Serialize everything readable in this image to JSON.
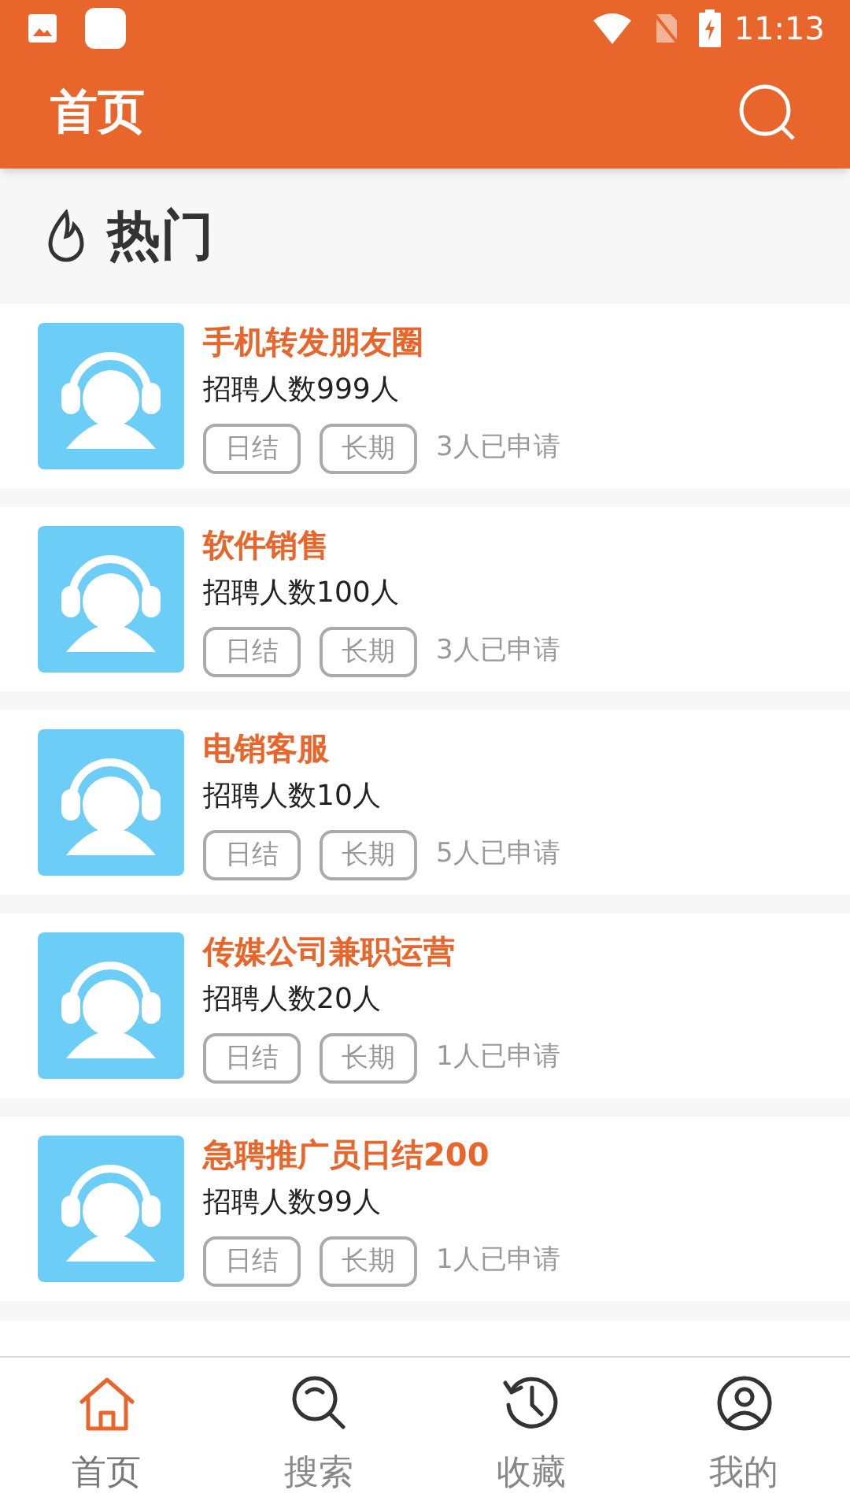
{
  "status_bar": {
    "time": "11:13"
  },
  "header": {
    "title": "首页"
  },
  "section": {
    "title": "热门"
  },
  "jobs": [
    {
      "title": "手机转发朋友圈",
      "recruit": "招聘人数999人",
      "tags": [
        "日结",
        "长期"
      ],
      "applied": "3人已申请"
    },
    {
      "title": "软件销售",
      "recruit": "招聘人数100人",
      "tags": [
        "日结",
        "长期"
      ],
      "applied": "3人已申请"
    },
    {
      "title": "电销客服",
      "recruit": "招聘人数10人",
      "tags": [
        "日结",
        "长期"
      ],
      "applied": "5人已申请"
    },
    {
      "title": "传媒公司兼职运营",
      "recruit": "招聘人数20人",
      "tags": [
        "日结",
        "长期"
      ],
      "applied": "1人已申请"
    },
    {
      "title": "急聘推广员日结200",
      "recruit": "招聘人数99人",
      "tags": [
        "日结",
        "长期"
      ],
      "applied": "1人已申请"
    }
  ],
  "bottom_nav": [
    {
      "label": "首页",
      "kind": "home",
      "selected": true
    },
    {
      "label": "搜索",
      "kind": "search",
      "selected": false
    },
    {
      "label": "收藏",
      "kind": "history",
      "selected": false
    },
    {
      "label": "我的",
      "kind": "user",
      "selected": false
    }
  ]
}
